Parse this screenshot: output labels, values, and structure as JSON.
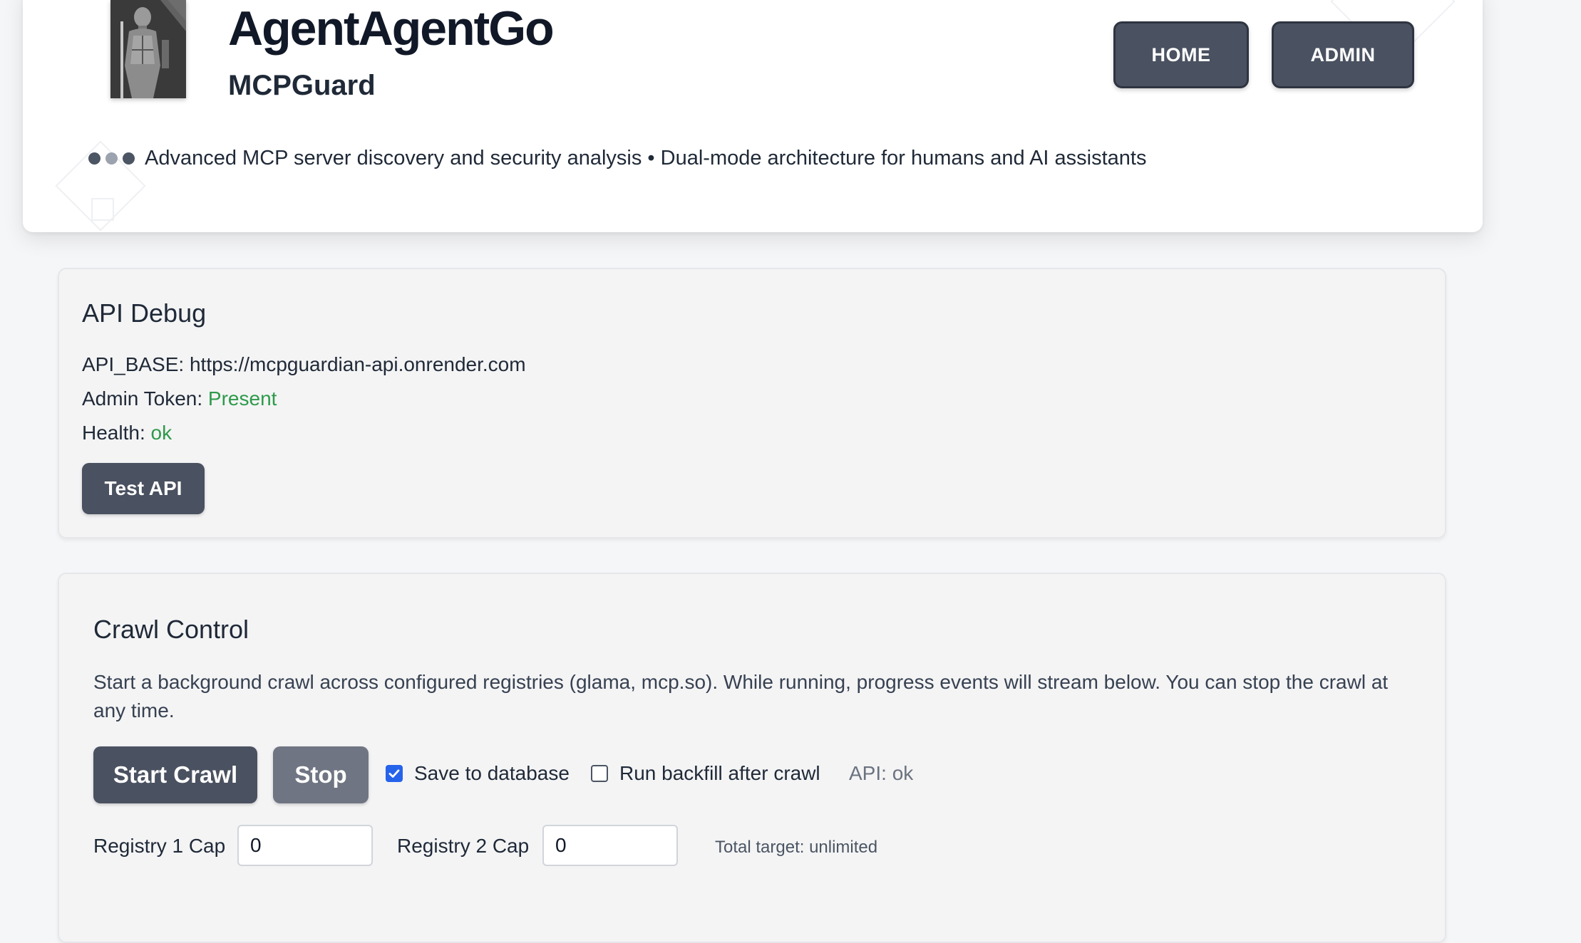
{
  "header": {
    "title": "AgentAgentGo",
    "subtitle": "MCPGuard",
    "tagline": "Advanced MCP server discovery and security analysis • Dual-mode architecture for humans and AI assistants",
    "nav": {
      "home_label": "HOME",
      "admin_label": "ADMIN"
    },
    "logo_icon": "knight-icon",
    "menu_dots_icon": "dots-icon"
  },
  "api_debug": {
    "title": "API Debug",
    "api_base_label": "API_BASE:",
    "api_base_value": "https://mcpguardian-api.onrender.com",
    "admin_token_label": "Admin Token:",
    "admin_token_value": "Present",
    "health_label": "Health:",
    "health_value": "ok",
    "test_button_label": "Test API"
  },
  "crawl_control": {
    "title": "Crawl Control",
    "description": "Start a background crawl across configured registries (glama, mcp.so). While running, progress events will stream below. You can stop the crawl at any time.",
    "start_label": "Start Crawl",
    "stop_label": "Stop",
    "save_to_db_label": "Save to database",
    "save_to_db_checked": true,
    "backfill_label": "Run backfill after crawl",
    "backfill_checked": false,
    "api_status": "API: ok",
    "registry1_label": "Registry 1 Cap",
    "registry1_value": "0",
    "registry2_label": "Registry 2 Cap",
    "registry2_value": "0",
    "total_target": "Total target: unlimited"
  },
  "colors": {
    "accent_dark": "#4a5160",
    "ok_green": "#2e9a4a",
    "checkbox_blue": "#2563eb"
  }
}
